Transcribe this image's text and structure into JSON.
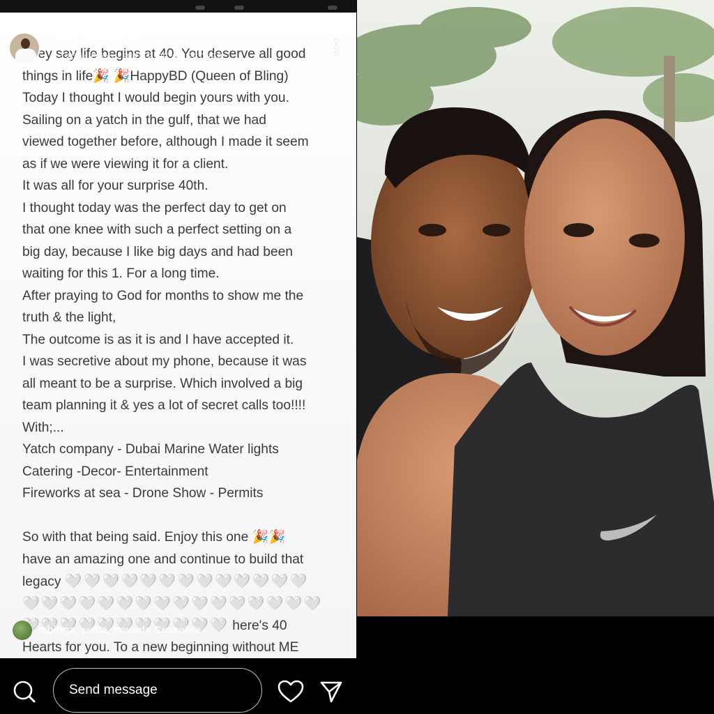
{
  "story": {
    "username": "mrkmations_2h",
    "music": "♫ Billie Eilish · BIRDS OF A FEATHER",
    "caption_lines": [
      "They say life begins at 40. You deserve all good",
      "things in life🎉 🎉HappyBD (Queen of Bling)",
      "Today I thought I would begin yours with you.",
      "Sailing on a yatch in the gulf, that we had",
      "viewed together before, although I made it seem",
      "as if we were viewing it for a client.",
      "It was all for your surprise 40th.",
      "I thought today was the perfect day to get on",
      "that one knee with such a perfect setting on a",
      "big day, because I like big days and had been",
      "waiting for this 1. For a long time.",
      "After praying to God for months to show me the",
      "truth & the light,",
      "The outcome is as it is and I have accepted it.",
      "I was secretive about my phone, because it was",
      "all meant to be a surprise. Which involved a big",
      "team planning it & yes a lot of secret calls too!!!!",
      "With;...",
      "Yatch company - Dubai Marine Water lights",
      "Catering -Decor- Entertainment",
      "Fireworks at sea - Drone Show - Permits",
      "",
      "So with that being said. Enjoy this one 🎉🎉",
      "have an amazing one and continue to build that",
      "legacy"
    ],
    "hearts_row_1": "🤍🤍🤍🤍🤍🤍🤍🤍🤍🤍🤍🤍🤍",
    "hearts_row_2": "🤍🤍🤍🤍🤍🤍🤍🤍🤍🤍🤍🤍🤍🤍🤍🤍",
    "hearts_row_3": "🤍🤍🤍🤍🤍🤍🤍🤍🤍🤍🤍",
    "after_hearts": " here's 40",
    "last_line": "Hearts for you. To a new beginning without ME",
    "commenter": "mbinga_yema_pounds Ceasefire"
  },
  "bottom_bar": {
    "message_placeholder": "Send message"
  },
  "icons": {
    "search": "search-icon",
    "heart": "heart-icon",
    "send": "send-icon",
    "more": "more-icon"
  },
  "photo": {
    "brand_mark": "swoosh-logo"
  }
}
